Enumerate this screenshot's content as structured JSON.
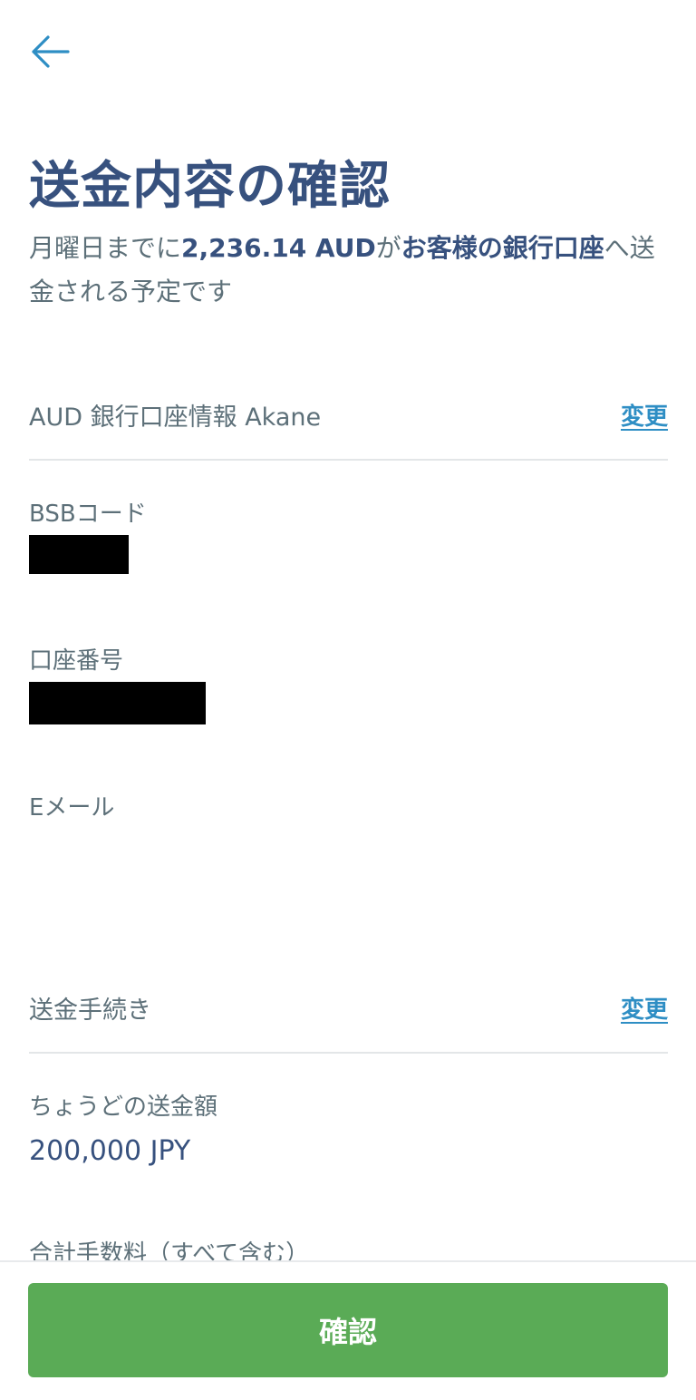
{
  "nav": {
    "back_icon": "arrow-left-icon"
  },
  "title": "送金内容の確認",
  "subtitle": {
    "part1": "月曜日までに",
    "amount": "2,236.14 AUD",
    "part2": "が",
    "destination": "お客様の銀行口座",
    "part3": "へ送金される予定です"
  },
  "recipient": {
    "heading": "AUD 銀行口座情報 Akane",
    "change_label": "変更",
    "bsb_label": "BSBコード",
    "account_label": "口座番号",
    "email_label": "Eメール"
  },
  "transfer": {
    "heading": "送金手続き",
    "change_label": "変更",
    "exact_amount_label": "ちょうどの送金額",
    "exact_amount_value": "200,000 JPY",
    "total_fee_label": "合計手数料（すべて含む）"
  },
  "footer": {
    "confirm_label": "確認"
  },
  "colors": {
    "accent": "#2e8ec4",
    "heading": "#37517e",
    "text": "#5d7079",
    "button": "#5aab56"
  }
}
